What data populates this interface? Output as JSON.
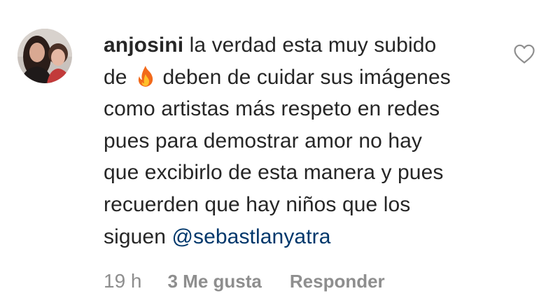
{
  "comment": {
    "username": "anjosini",
    "lines": [
      "la verdad esta muy subido",
      "de",
      "deben de cuidar sus imágenes",
      "como artistas más respeto en redes",
      "pues para demostrar amor no hay",
      "que excibirlo de esta manera y pues",
      "recuerden que hay niños que los",
      "siguen"
    ],
    "mention": "@sebastlanyatra",
    "emoji": "fire-icon"
  },
  "meta": {
    "time": "19 h",
    "likes": "3 Me gusta",
    "reply": "Responder"
  },
  "icons": {
    "like": "heart-outline-icon",
    "avatar": "profile-photo"
  },
  "colors": {
    "text": "#262626",
    "secondary": "#8e8e8e",
    "mention": "#00376b",
    "background": "#ffffff"
  }
}
